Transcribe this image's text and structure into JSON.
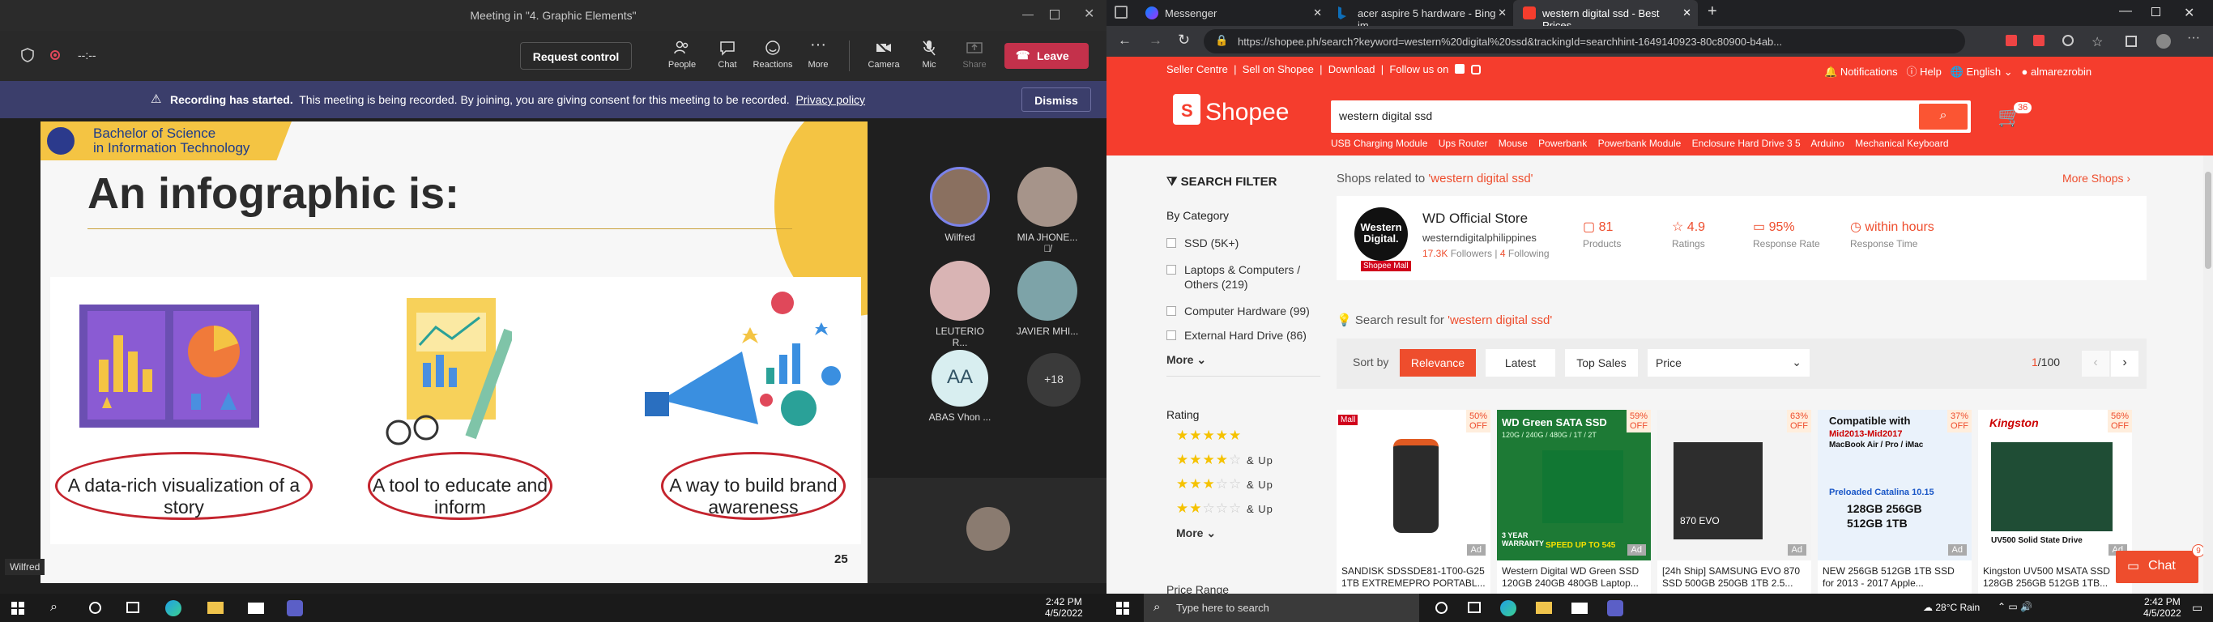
{
  "teams": {
    "window_title": "Meeting in \"4. Graphic Elements\"",
    "timer": "--:--",
    "request_control": "Request control",
    "tools": [
      "People",
      "Chat",
      "Reactions",
      "More",
      "Camera",
      "Mic",
      "Share"
    ],
    "leave": "Leave",
    "banner_title": "Recording has started.",
    "banner_text": "This meeting is being recorded. By joining, you are giving consent for this meeting to be recorded.",
    "banner_link": "Privacy policy",
    "dismiss": "Dismiss",
    "slide": {
      "header_line1": "Bachelor of Science",
      "header_line2": "in Information Technology",
      "title": "An infographic is:",
      "items": [
        "A data-rich visualization of a story",
        "A tool to educate and inform",
        "A way to build brand awareness"
      ],
      "page_number": "25"
    },
    "participants": [
      {
        "name": "Wilfred"
      },
      {
        "name": "MIA JHONE..."
      },
      {
        "name": "LEUTERIO R..."
      },
      {
        "name": "JAVIER MHI..."
      },
      {
        "name": "ABAS Vhon ...",
        "initials": "AA"
      }
    ],
    "overflow_count": "+18",
    "speaker_label": "Wilfred"
  },
  "taskbar_left": {
    "time": "2:42 PM",
    "date": "4/5/2022"
  },
  "browser": {
    "tabs": [
      "Messenger",
      "acer aspire 5 hardware - Bing im...",
      "western digital ssd - Best Prices..."
    ],
    "url": "https://shopee.ph/search?keyword=western%20digital%20ssd&trackingId=searchhint-1649140923-80c80900-b4ab..."
  },
  "shopee": {
    "top_links": [
      "Seller Centre",
      "Sell on Shopee",
      "Download",
      "Follow us on"
    ],
    "notifications": "Notifications",
    "help": "Help",
    "language": "English",
    "username": "almarezrobin",
    "logo": "Shopee",
    "search_value": "western digital ssd",
    "cart_count": "36",
    "suggestions": [
      "USB Charging Module",
      "Ups Router",
      "Mouse",
      "Powerbank",
      "Powerbank Module",
      "Enclosure Hard Drive 3 5",
      "Arduino",
      "Mechanical Keyboard"
    ],
    "filter_title": "SEARCH FILTER",
    "by_category": "By Category",
    "categories": [
      "SSD (5K+)",
      "Laptops & Computers / Others (219)",
      "Computer Hardware (99)",
      "External Hard Drive (86)"
    ],
    "more": "More",
    "rating": "Rating",
    "and_up": "& Up",
    "price_range": "Price Range",
    "shops_related": "Shops related to ",
    "query_quoted": "'western digital ssd'",
    "more_shops": "More Shops",
    "shop": {
      "name": "WD Official Store",
      "logo_text": "Western Digital.",
      "mall": "Shopee Mall",
      "handle": "westerndigitalphilippines",
      "followers": "17.3K",
      "followers_label": "Followers",
      "following": "4",
      "following_label": "Following",
      "stats": [
        {
          "value": "81",
          "label": "Products"
        },
        {
          "value": "4.9",
          "label": "Ratings"
        },
        {
          "value": "95%",
          "label": "Response Rate"
        },
        {
          "value": "within hours",
          "label": "Response Time"
        }
      ]
    },
    "search_result_for": "Search result for ",
    "sort_by": "Sort by",
    "sort_options": [
      "Relevance",
      "Latest",
      "Top Sales"
    ],
    "price_select": "Price",
    "page": "1",
    "page_total": "/100",
    "products": [
      {
        "name": "SANDISK SDSSDE81-1T00-G25 1TB EXTREMEPRO PORTABL...",
        "discount": "50%",
        "mall": "Mall"
      },
      {
        "name": "Western Digital WD Green SSD 120GB 240GB 480GB Laptop...",
        "discount": "59%",
        "banner": "WD Green SATA SSD",
        "sub": "120G / 240G / 480G / 1T / 2T",
        "warranty": "3 YEAR WARRANTY",
        "speed": "SPEED UP TO 545"
      },
      {
        "name": "[24h Ship] SAMSUNG EVO 870 SSD 500GB 250GB 1TB 2.5...",
        "discount": "63%",
        "label": "870 EVO"
      },
      {
        "name": "NEW 256GB 512GB 1TB SSD for 2013 - 2017 Apple...",
        "discount": "37%",
        "banner": "Compatible with",
        "sub": "Mid2013-Mid2017",
        "sub2": "MacBook Air / Pro / iMac",
        "pre": "Preloaded Catalina 10.15",
        "sizes": "128GB  256GB",
        "size2": "512GB  1TB"
      },
      {
        "name": "Kingston UV500 MSATA SSD 128GB 256GB 512GB 1TB...",
        "discount": "56%",
        "brand": "Kingston",
        "label": "UV500 Solid State Drive"
      }
    ],
    "ad": "Ad",
    "off": "OFF",
    "chat": "Chat",
    "chat_badge": "9"
  },
  "taskbar_right": {
    "search_placeholder": "Type here to search",
    "weather": "28°C  Rain",
    "time": "2:42 PM",
    "date": "4/5/2022"
  },
  "colors": {
    "shopee_orange": "#f53d2d",
    "teams_bar": "#3b3e6b",
    "leave_red": "#c4314b"
  }
}
